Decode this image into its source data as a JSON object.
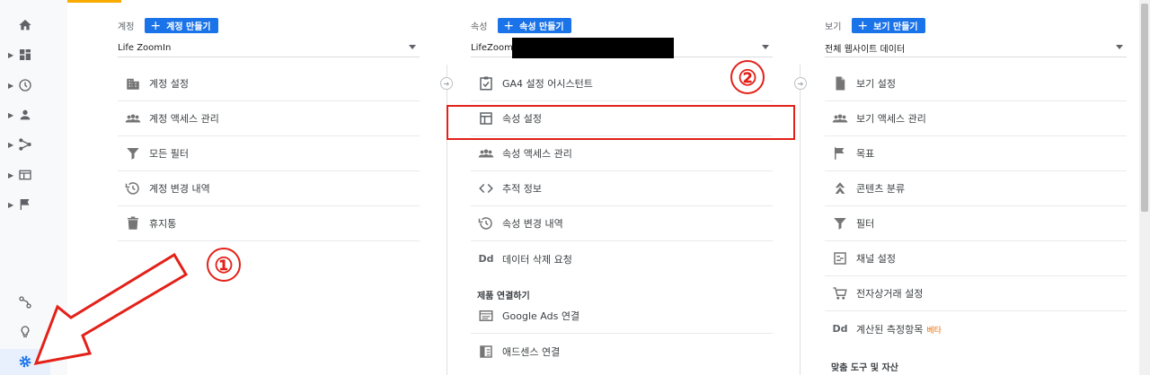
{
  "account": {
    "label": "계정",
    "create_button": "계정 만들기",
    "selected": "Life ZoomIn",
    "items": [
      {
        "label": "계정 설정",
        "icon": "building-icon"
      },
      {
        "label": "계정 액세스 관리",
        "icon": "people-icon"
      },
      {
        "label": "모든 필터",
        "icon": "filter-icon"
      },
      {
        "label": "계정 변경 내역",
        "icon": "history-icon"
      },
      {
        "label": "휴지통",
        "icon": "trash-icon"
      }
    ]
  },
  "property": {
    "label": "속성",
    "create_button": "속성 만들기",
    "selected": "LifeZoomIn",
    "items": [
      {
        "label": "GA4 설정 어시스턴트",
        "icon": "checklist-icon"
      },
      {
        "label": "속성 설정",
        "icon": "layout-icon"
      },
      {
        "label": "속성 액세스 관리",
        "icon": "people-icon"
      },
      {
        "label": "추적 정보",
        "icon": "code-icon"
      },
      {
        "label": "속성 변경 내역",
        "icon": "history-icon"
      },
      {
        "label": "데이터 삭제 요청",
        "icon": "dd-icon"
      }
    ],
    "product_links_title": "제품 연결하기",
    "product_links": [
      {
        "label": "Google Ads 연결",
        "icon": "ads-icon"
      },
      {
        "label": "애드센스 연결",
        "icon": "adsense-icon"
      }
    ]
  },
  "view": {
    "label": "보기",
    "create_button": "보기 만들기",
    "selected": "전체 웹사이트 데이터",
    "items": [
      {
        "label": "보기 설정",
        "icon": "document-icon"
      },
      {
        "label": "보기 액세스 관리",
        "icon": "people-icon"
      },
      {
        "label": "목표",
        "icon": "flag-icon"
      },
      {
        "label": "콘텐츠 분류",
        "icon": "grouping-icon"
      },
      {
        "label": "필터",
        "icon": "filter-icon"
      },
      {
        "label": "채널 설정",
        "icon": "channel-icon"
      },
      {
        "label": "전자상거래 설정",
        "icon": "cart-icon"
      },
      {
        "label": "계산된 측정항목",
        "icon": "dd-icon",
        "badge": "베타"
      }
    ],
    "tools_title": "맞춤 도구 및 자산"
  },
  "annotations": {
    "marker_1": "①",
    "marker_2": "②",
    "color": "#e32119"
  },
  "colors": {
    "accent": "#1a73e8",
    "tab_indicator": "#f9ab00"
  }
}
